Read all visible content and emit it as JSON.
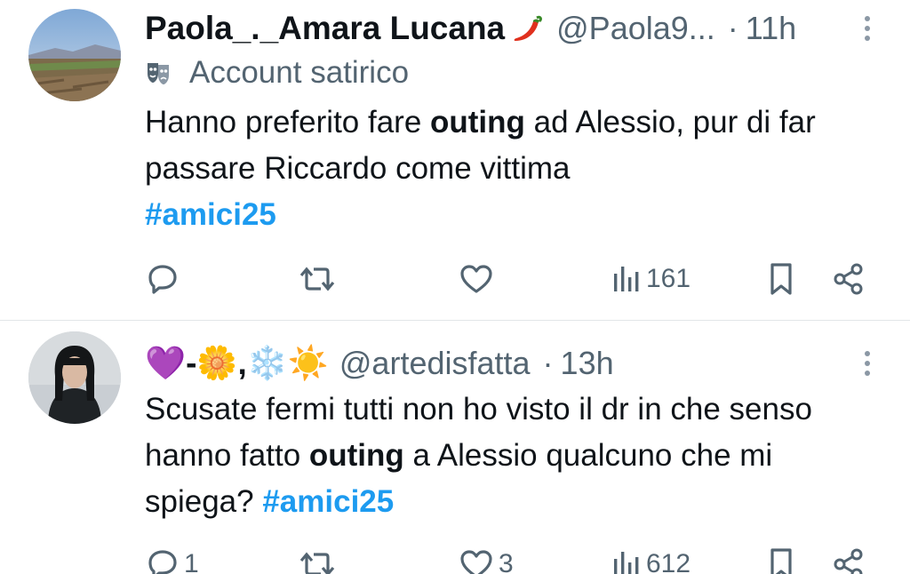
{
  "tweets": [
    {
      "display_name": "Paola_._Amara Lucana",
      "name_emoji": "hot-pepper",
      "handle": "@Paola9...",
      "separator": "·",
      "time": "11h",
      "label_icon": "theater-masks-icon",
      "label": "Account satirico",
      "text": {
        "part1": "Hanno preferito fare ",
        "bold": "outing",
        "part2": " ad Alessio, pur di far passare Riccardo come vittima",
        "hashtag": "#amici25"
      },
      "actions": {
        "replies": "",
        "reposts": "",
        "likes": "",
        "views": "161"
      }
    },
    {
      "display_name": "💜-🌼,❄️☀️",
      "handle": "@artedisfatta",
      "separator": "·",
      "time": "13h",
      "text": {
        "part1": "Scusate fermi tutti non ho visto il dr in che senso hanno fatto ",
        "bold": "outing",
        "part2": " a Alessio qualcuno che mi spiega? ",
        "hashtag": "#amici25"
      },
      "actions": {
        "replies": "1",
        "reposts": "",
        "likes": "3",
        "views": "612"
      }
    }
  ],
  "colors": {
    "text": "#0f1419",
    "secondary": "#536471",
    "link": "#1d9bf0",
    "divider": "#e3e6e8"
  }
}
